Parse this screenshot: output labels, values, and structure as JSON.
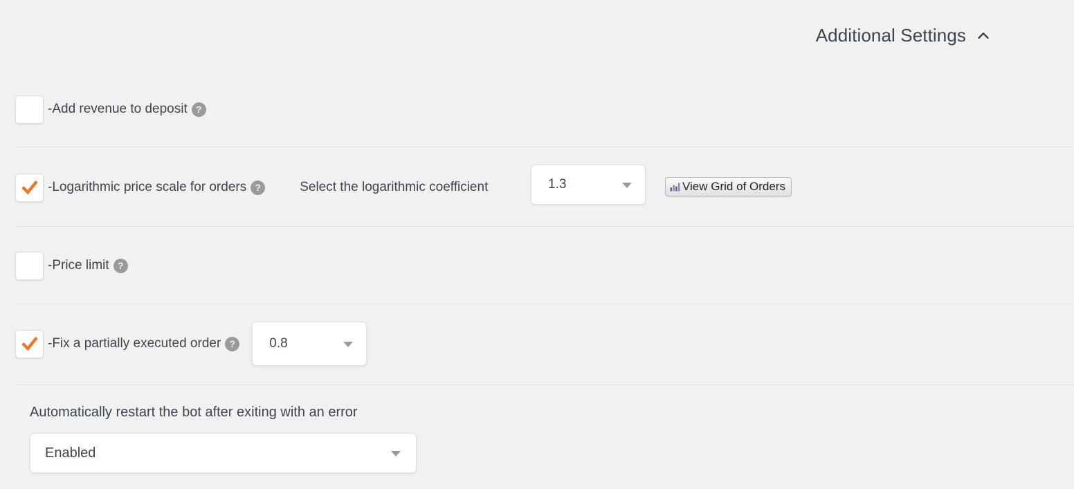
{
  "header": {
    "title": "Additional Settings",
    "collapse_icon": "chevron-up-icon"
  },
  "rows": [
    {
      "id": "add-revenue-to-deposit",
      "label": "-Add revenue to deposit",
      "checked": false,
      "help_icon": "question-mark-icon",
      "help_glyph": "?"
    },
    {
      "id": "logarithmic-price-scale",
      "label": "-Logarithmic price scale for orders",
      "checked": true,
      "help_icon": "question-mark-icon",
      "help_glyph": "?",
      "inline_label": "Select the logarithmic coefficient",
      "select_value": "1.3",
      "button_label": "View Grid of Orders",
      "button_icon": "bar-chart-icon"
    },
    {
      "id": "price-limit",
      "label": "-Price limit",
      "checked": false,
      "help_icon": "question-mark-icon",
      "help_glyph": "?"
    },
    {
      "id": "fix-partially-executed-order",
      "label": "-Fix a partially executed order",
      "checked": true,
      "help_icon": "question-mark-icon",
      "help_glyph": "?",
      "select_value": "0.8"
    }
  ],
  "restart": {
    "label": "Automatically restart the bot after exiting with an error",
    "value": "Enabled"
  },
  "colors": {
    "background": "#f1f1f1",
    "text": "#3b4551",
    "accent_orange": "#ef7622",
    "divider": "#e2e2e2",
    "help_gray": "#9a9a9a",
    "field_background": "#ffffff"
  }
}
